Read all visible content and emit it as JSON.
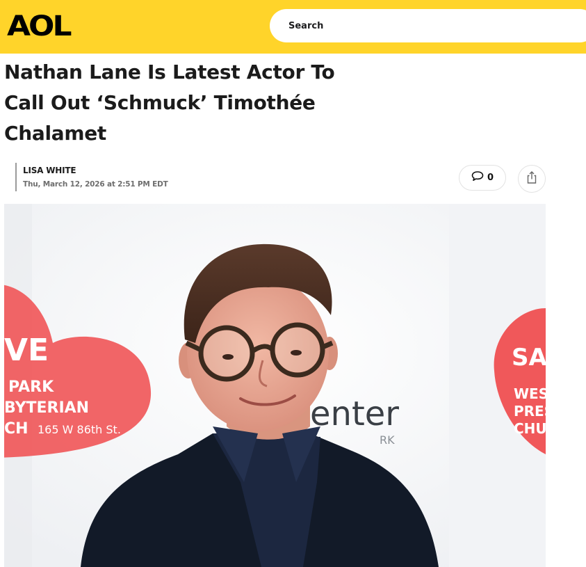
{
  "header": {
    "logo_text": "AOL",
    "search_placeholder": "Search",
    "background_color": "#FFD42A"
  },
  "article": {
    "title": "Nathan Lane Is Latest Actor To Call Out ‘Schmuck’ Timothée Chalamet",
    "author": "LISA WHITE",
    "date": "Thu, March 12, 2026 at 2:51 PM EDT",
    "comments_count": "0",
    "comment_icon": "speech-bubble-icon",
    "share_icon": "share-icon"
  },
  "hero_image": {
    "backdrop_left_lines": [
      "VE",
      "PARK",
      "BYTERIAN",
      "CH",
      "165 W 86th St."
    ],
    "backdrop_center_text": "enter",
    "backdrop_center_small": "RK",
    "backdrop_right_lines": [
      "SA",
      "WES",
      "PRES",
      "CHU"
    ],
    "heart_color": "#F0585A"
  }
}
